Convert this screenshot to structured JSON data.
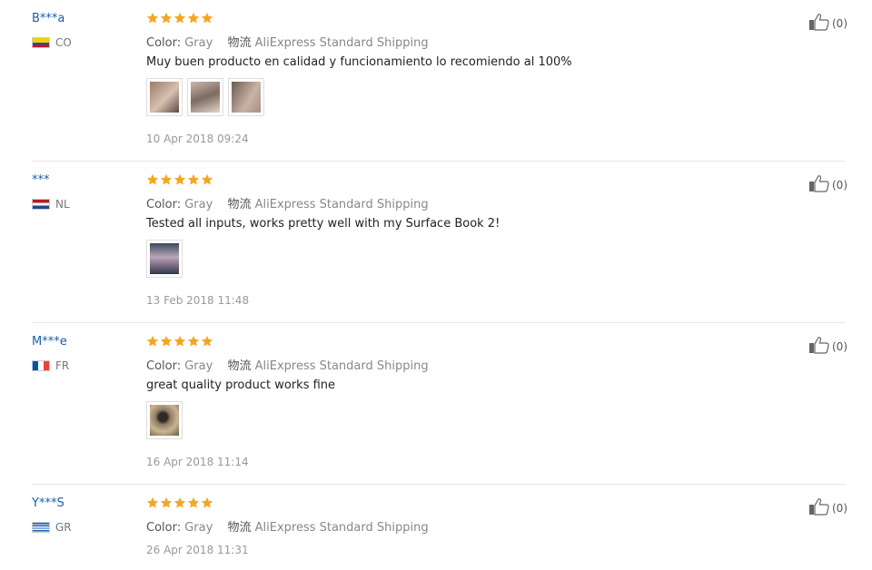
{
  "reviews": [
    {
      "user": "B***a",
      "country": "CO",
      "flag_colors": [
        "#f5d000",
        "#1f4fa0",
        "#ce1126"
      ],
      "rating": 5,
      "color_label": "Color:",
      "color_value": "Gray",
      "logistics_label": "物流",
      "logistics_value": "AliExpress Standard Shipping",
      "text": "Muy buen producto en calidad y funcionamiento lo recomiendo al 100%",
      "photos": 3,
      "date": "10 Apr 2018 09:24",
      "helpful": "(0)"
    },
    {
      "user": "***",
      "country": "NL",
      "flag_colors": [
        "#ae1c28",
        "#ffffff",
        "#21468b"
      ],
      "rating": 5,
      "color_label": "Color:",
      "color_value": "Gray",
      "logistics_label": "物流",
      "logistics_value": "AliExpress Standard Shipping",
      "text": "Tested all inputs, works pretty well with my Surface Book 2!",
      "photos": 1,
      "date": "13 Feb 2018 11:48",
      "helpful": "(0)"
    },
    {
      "user": "M***e",
      "country": "FR",
      "flag_colors": [
        "#0055a4",
        "#ffffff",
        "#ef4135"
      ],
      "rating": 5,
      "color_label": "Color:",
      "color_value": "Gray",
      "logistics_label": "物流",
      "logistics_value": "AliExpress Standard Shipping",
      "text": "great quality product works fine",
      "photos": 1,
      "date": "16 Apr 2018 11:14",
      "helpful": "(0)"
    },
    {
      "user": "Y***S",
      "country": "GR",
      "flag_colors": [
        "#0d5eaf",
        "#ffffff"
      ],
      "rating": 5,
      "color_label": "Color:",
      "color_value": "Gray",
      "logistics_label": "物流",
      "logistics_value": "AliExpress Standard Shipping",
      "text": "",
      "photos": 0,
      "date": "26 Apr 2018 11:31",
      "helpful": "(0)"
    }
  ],
  "colors": {
    "star": "#f5a623",
    "username": "#1a5fa8",
    "divider": "#e6e6e6"
  }
}
